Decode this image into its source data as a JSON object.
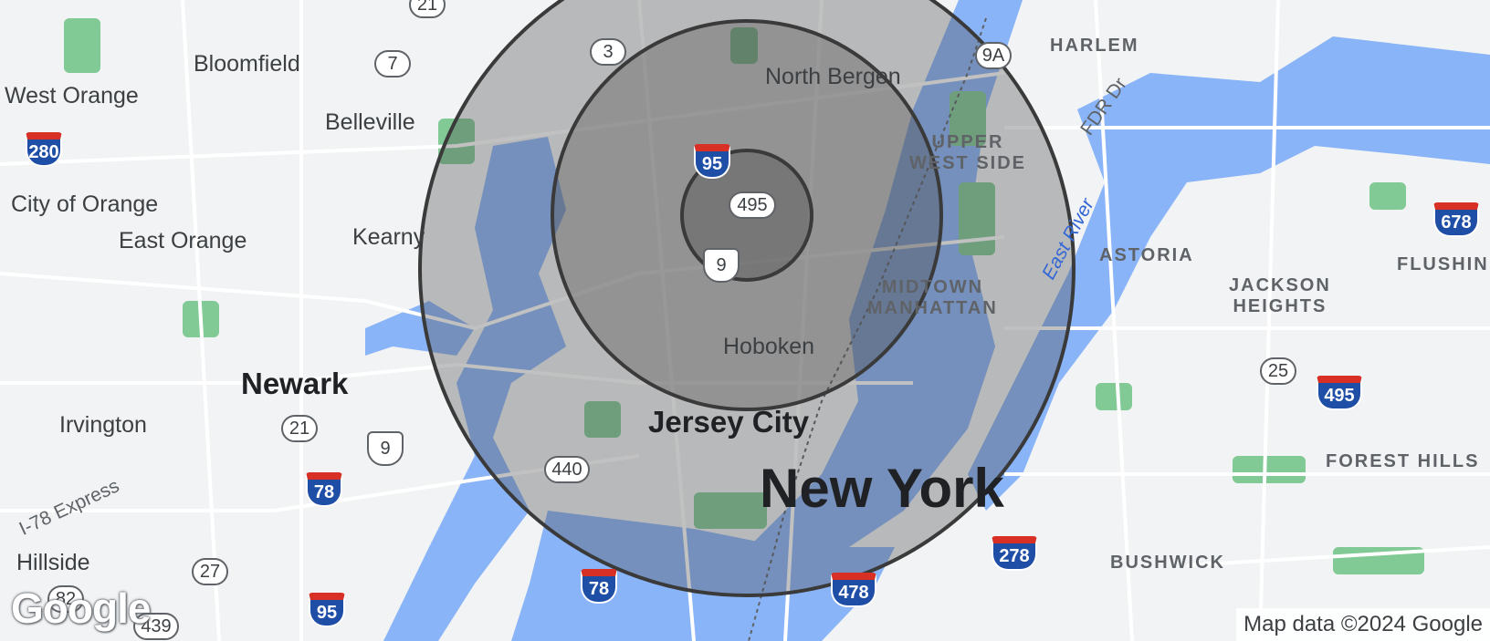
{
  "map": {
    "cities": {
      "bloomfield": "Bloomfield",
      "west_orange": "West Orange",
      "belleville": "Belleville",
      "city_of_orange": "City of Orange",
      "east_orange": "East Orange",
      "kearny": "Kearny",
      "north_bergen": "North Bergen",
      "newark": "Newark",
      "irvington": "Irvington",
      "hoboken": "Hoboken",
      "jersey_city": "Jersey City",
      "new_york": "New York",
      "hillside": "Hillside"
    },
    "neighborhoods": {
      "harlem": "HARLEM",
      "upper_west_side": "UPPER\nWEST SIDE",
      "astoria": "ASTORIA",
      "jackson_heights": "JACKSON\nHEIGHTS",
      "midtown_manhattan": "MIDTOWN\nMANHATTAN",
      "flushing": "FLUSHIN",
      "forest_hills": "FOREST HILLS",
      "bushwick": "BUSHWICK"
    },
    "roads": {
      "fdr_dr": "FDR Dr",
      "east_river": "East River",
      "i78_express": "I-78 Express"
    },
    "shields": {
      "r21_top": "21",
      "r3": "3",
      "r7": "7",
      "r9a": "9A",
      "i280": "280",
      "i95_center": "95",
      "r495": "495",
      "us9_center": "9",
      "r21": "21",
      "us9": "9",
      "r440": "440",
      "i78_left": "78",
      "i78_mid": "78",
      "i95_bottom": "95",
      "i478": "478",
      "i278": "278",
      "r25": "25",
      "i495_right": "495",
      "i678": "678",
      "r27": "27",
      "r82": "82",
      "r439": "439"
    },
    "radius_rings": {
      "count": 3,
      "fill_color": "#4d4d4d",
      "stroke_color": "#3a3a3a"
    },
    "colors": {
      "water": "#8ab4f8",
      "park": "#81c995",
      "land": "#f1f3f4",
      "road": "#ffffff",
      "header": "#174a7e"
    }
  },
  "branding": {
    "logo": "Google",
    "attribution": "Map data ©2024 Google"
  }
}
